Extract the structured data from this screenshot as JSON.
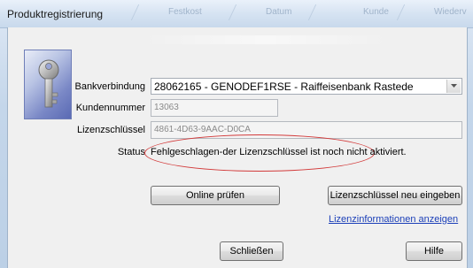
{
  "window": {
    "title": "Produktregistrierung",
    "background_labels": [
      "Festkost",
      "Datum",
      "Kunde",
      "Wiederv"
    ]
  },
  "form": {
    "bank_label": "Bankverbindung",
    "bank_value": "28062165 - GENODEF1RSE - Raiffeisenbank Rastede",
    "customer_label": "Kundennummer",
    "customer_value": "13063",
    "license_label": "Lizenzschlüssel",
    "license_value": "4861-4D63-9AAC-D0CA",
    "status_label": "Status",
    "status_value": "Fehlgeschlagen-der Lizenzschlüssel ist noch nicht aktiviert."
  },
  "buttons": {
    "online_check": "Online prüfen",
    "new_license": "Lizenzschlüssel neu eingeben",
    "license_info_link": "Lizenzinformationen anzeigen",
    "close": "Schließen",
    "help": "Hilfe"
  },
  "colors": {
    "status_highlight": "#d23a3a",
    "link": "#1b3fb8"
  },
  "icons": {
    "dropdown": "chevron-down-icon",
    "key": "key-icon"
  }
}
